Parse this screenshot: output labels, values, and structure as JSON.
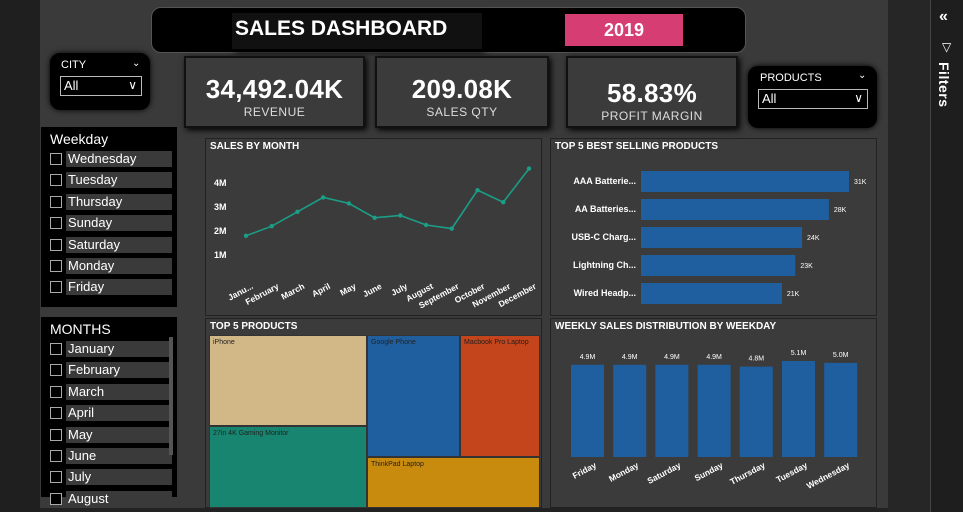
{
  "header": {
    "title": "SALES DASHBOARD",
    "year": "2019"
  },
  "city_slicer": {
    "title": "CITY",
    "value": "All"
  },
  "products_slicer": {
    "title": "PRODUCTS",
    "value": "All"
  },
  "kpis": [
    {
      "value": "34,492.04K",
      "label": "REVENUE"
    },
    {
      "value": "209.08K",
      "label": "SALES QTY"
    },
    {
      "value": "58.83%",
      "label": "PROFIT MARGIN"
    }
  ],
  "weekday_slicer": {
    "title": "Weekday",
    "items": [
      "Wednesday",
      "Tuesday",
      "Thursday",
      "Sunday",
      "Saturday",
      "Monday",
      "Friday"
    ]
  },
  "months_slicer": {
    "title": "MONTHS",
    "items": [
      "January",
      "February",
      "March",
      "April",
      "May",
      "June",
      "July",
      "August"
    ]
  },
  "filters_pane": {
    "label": "Filters"
  },
  "colors": {
    "accent": "#d63e73",
    "teal": "#1a9e86",
    "blue": "#1f5fa0",
    "tan": "#d2b887",
    "orange": "#c4441b",
    "green": "#17856f",
    "gold": "#c98b0e"
  },
  "chart_data": [
    {
      "type": "line",
      "title": "SALES BY MONTH",
      "categories": [
        "January",
        "February",
        "March",
        "April",
        "May",
        "June",
        "July",
        "August",
        "September",
        "October",
        "November",
        "December"
      ],
      "category_labels": [
        "Janu...",
        "February",
        "March",
        "April",
        "May",
        "June",
        "July",
        "August",
        "September",
        "October",
        "November",
        "December"
      ],
      "values": [
        1.8,
        2.2,
        2.8,
        3.4,
        3.15,
        2.55,
        2.65,
        2.25,
        2.1,
        3.7,
        3.2,
        4.6
      ],
      "yticks": [
        "1M",
        "2M",
        "3M",
        "4M"
      ],
      "ylim": [
        0,
        5
      ]
    },
    {
      "type": "bar",
      "title": "TOP 5 BEST SELLING PRODUCTS",
      "categories": [
        "AAA Batterie...",
        "AA Batteries...",
        "USB-C Charg...",
        "Lightning Ch...",
        "Wired Headp..."
      ],
      "values": [
        31,
        28,
        24,
        23,
        21
      ],
      "data_labels": [
        "31K",
        "28K",
        "24K",
        "23K",
        "21K"
      ],
      "orientation": "horizontal"
    },
    {
      "type": "treemap",
      "title": "TOP 5 PRODUCTS",
      "categories": [
        "iPhone",
        "Google Phone",
        "Macbook Pro Laptop",
        "27in 4K Gaming Monitor",
        "ThinkPad Laptop"
      ]
    },
    {
      "type": "bar",
      "title": "WEEKLY SALES DISTRIBUTION BY WEEKDAY",
      "categories": [
        "Friday",
        "Monday",
        "Saturday",
        "Sunday",
        "Thursday",
        "Tuesday",
        "Wednesday"
      ],
      "values": [
        4.9,
        4.9,
        4.9,
        4.9,
        4.8,
        5.1,
        5.0
      ],
      "data_labels": [
        "4.9M",
        "4.9M",
        "4.9M",
        "4.9M",
        "4.8M",
        "5.1M",
        "5.0M"
      ]
    }
  ]
}
